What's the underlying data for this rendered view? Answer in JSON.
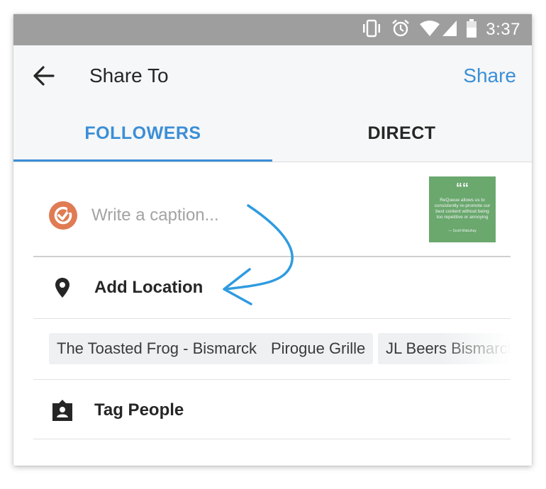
{
  "status_bar": {
    "time": "3:37",
    "icons": [
      "vibrate-icon",
      "alarm-icon",
      "wifi-icon",
      "signal-icon",
      "battery-icon"
    ]
  },
  "header": {
    "title": "Share To",
    "share_label": "Share",
    "back_icon": "back-arrow-icon"
  },
  "tabs": [
    {
      "label": "FOLLOWERS",
      "active": true
    },
    {
      "label": "DIRECT",
      "active": false
    }
  ],
  "caption": {
    "placeholder": "Write a caption...",
    "value": ""
  },
  "thumbnail": {
    "quote_mark": "““",
    "text": "ReQueue allows us to consistently re-promote our best content without being too repetitive or annoying",
    "attribution": "— Scott Mabuhay"
  },
  "location": {
    "label": "Add Location",
    "icon": "location-pin-icon",
    "suggestions": [
      "The Toasted Frog - Bismarck",
      "Pirogue Grille",
      "JL Beers Bismarck"
    ]
  },
  "tag_people": {
    "label": "Tag People",
    "icon": "person-tag-icon"
  },
  "colors": {
    "accent": "#3b8fd6",
    "status_bar": "#9e9e9e",
    "avatar_ring": "#e07b53",
    "thumbnail_bg": "#6aa86e",
    "annotation_arrow": "#2f9be0"
  }
}
